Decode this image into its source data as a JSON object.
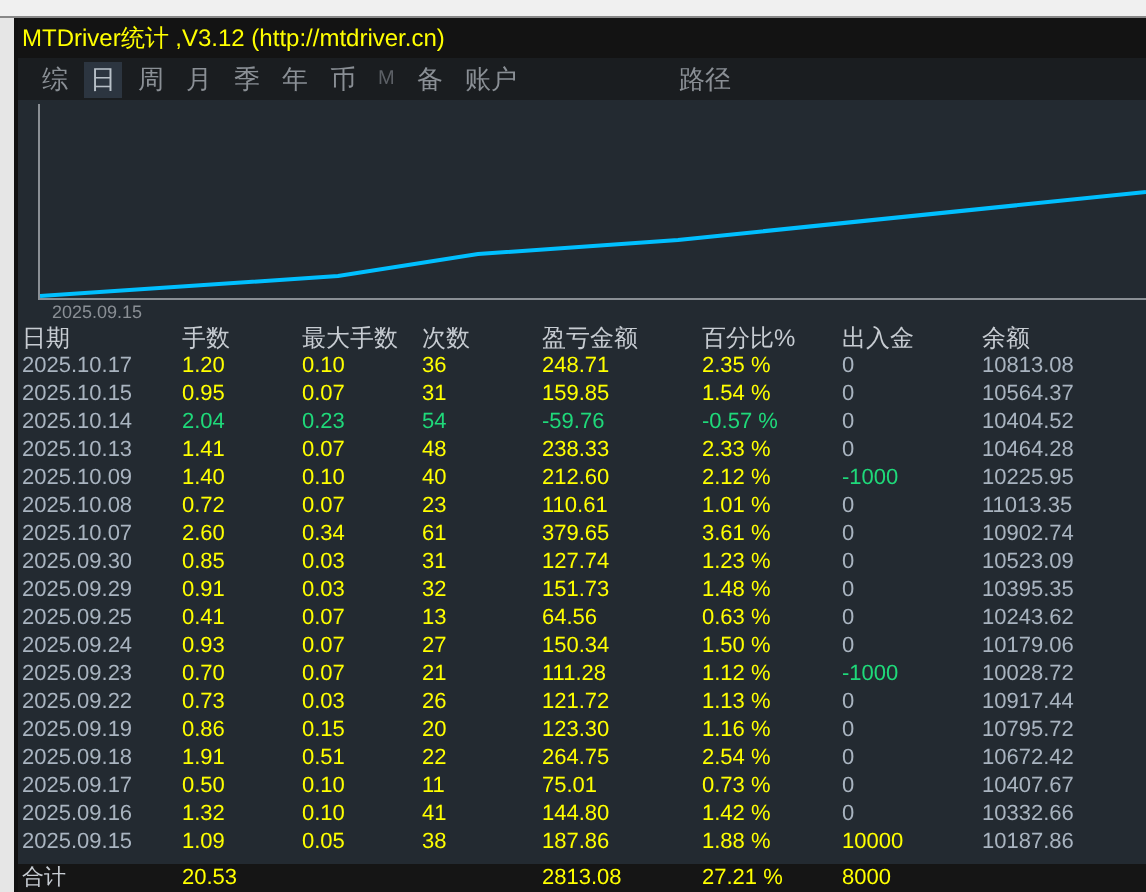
{
  "window": {
    "title": "MTDriver统计 ,V3.12 (http://mtdriver.cn)"
  },
  "tabs": [
    {
      "label": "综",
      "selected": false,
      "disabled": false
    },
    {
      "label": "日",
      "selected": true,
      "disabled": false
    },
    {
      "label": "周",
      "selected": false,
      "disabled": false
    },
    {
      "label": "月",
      "selected": false,
      "disabled": false
    },
    {
      "label": "季",
      "selected": false,
      "disabled": false
    },
    {
      "label": "年",
      "selected": false,
      "disabled": false
    },
    {
      "label": "币",
      "selected": false,
      "disabled": false
    },
    {
      "label": "M",
      "selected": false,
      "disabled": true
    },
    {
      "label": "备",
      "selected": false,
      "disabled": false
    },
    {
      "label": "账户",
      "selected": false,
      "disabled": false
    }
  ],
  "path_button": "路径",
  "chart": {
    "start_label": "2025.09.15"
  },
  "table": {
    "columns": [
      "日期",
      "手数",
      "最大手数",
      "次数",
      "盈亏金额",
      "百分比%",
      "出入金",
      "余额"
    ],
    "rows": [
      {
        "kind": "profit",
        "cells": [
          "2025.10.17",
          "1.20",
          "0.10",
          "36",
          "248.71",
          "2.35 %",
          "0",
          "10813.08"
        ]
      },
      {
        "kind": "profit",
        "cells": [
          "2025.10.15",
          "0.95",
          "0.07",
          "31",
          "159.85",
          "1.54 %",
          "0",
          "10564.37"
        ]
      },
      {
        "kind": "loss",
        "cells": [
          "2025.10.14",
          "2.04",
          "0.23",
          "54",
          "-59.76",
          "-0.57 %",
          "0",
          "10404.52"
        ]
      },
      {
        "kind": "profit",
        "cells": [
          "2025.10.13",
          "1.41",
          "0.07",
          "48",
          "238.33",
          "2.33 %",
          "0",
          "10464.28"
        ]
      },
      {
        "kind": "profit",
        "cells": [
          "2025.10.09",
          "1.40",
          "0.10",
          "40",
          "212.60",
          "2.12 %",
          "-1000",
          "10225.95"
        ]
      },
      {
        "kind": "profit",
        "cells": [
          "2025.10.08",
          "0.72",
          "0.07",
          "23",
          "110.61",
          "1.01 %",
          "0",
          "11013.35"
        ]
      },
      {
        "kind": "profit",
        "cells": [
          "2025.10.07",
          "2.60",
          "0.34",
          "61",
          "379.65",
          "3.61 %",
          "0",
          "10902.74"
        ]
      },
      {
        "kind": "profit",
        "cells": [
          "2025.09.30",
          "0.85",
          "0.03",
          "31",
          "127.74",
          "1.23 %",
          "0",
          "10523.09"
        ]
      },
      {
        "kind": "profit",
        "cells": [
          "2025.09.29",
          "0.91",
          "0.03",
          "32",
          "151.73",
          "1.48 %",
          "0",
          "10395.35"
        ]
      },
      {
        "kind": "profit",
        "cells": [
          "2025.09.25",
          "0.41",
          "0.07",
          "13",
          "64.56",
          "0.63 %",
          "0",
          "10243.62"
        ]
      },
      {
        "kind": "profit",
        "cells": [
          "2025.09.24",
          "0.93",
          "0.07",
          "27",
          "150.34",
          "1.50 %",
          "0",
          "10179.06"
        ]
      },
      {
        "kind": "profit",
        "cells": [
          "2025.09.23",
          "0.70",
          "0.07",
          "21",
          "111.28",
          "1.12 %",
          "-1000",
          "10028.72"
        ]
      },
      {
        "kind": "profit",
        "cells": [
          "2025.09.22",
          "0.73",
          "0.03",
          "26",
          "121.72",
          "1.13 %",
          "0",
          "10917.44"
        ]
      },
      {
        "kind": "profit",
        "cells": [
          "2025.09.19",
          "0.86",
          "0.15",
          "20",
          "123.30",
          "1.16 %",
          "0",
          "10795.72"
        ]
      },
      {
        "kind": "profit",
        "cells": [
          "2025.09.18",
          "1.91",
          "0.51",
          "22",
          "264.75",
          "2.54 %",
          "0",
          "10672.42"
        ]
      },
      {
        "kind": "profit",
        "cells": [
          "2025.09.17",
          "0.50",
          "0.10",
          "11",
          "75.01",
          "0.73 %",
          "0",
          "10407.67"
        ]
      },
      {
        "kind": "profit",
        "cells": [
          "2025.09.16",
          "1.32",
          "0.10",
          "41",
          "144.80",
          "1.42 %",
          "0",
          "10332.66"
        ]
      },
      {
        "kind": "profit",
        "cells": [
          "2025.09.15",
          "1.09",
          "0.05",
          "38",
          "187.86",
          "1.88 %",
          "10000",
          "10187.86"
        ]
      }
    ],
    "total": {
      "label": "合计",
      "lots": "20.53",
      "profit": "2813.08",
      "percent": "27.21 %",
      "flow": "8000"
    }
  }
}
